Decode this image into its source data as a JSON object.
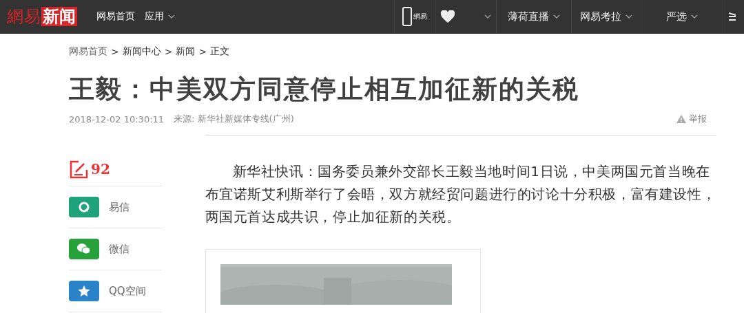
{
  "top_bar": {
    "logo": {
      "part_1": "網易",
      "part_2": "新闻"
    },
    "nav_links": [
      {
        "kind": "link",
        "label": "网易首页"
      },
      {
        "kind": "dropdown",
        "label": "应用"
      }
    ],
    "right_items": [
      {
        "kind": "phone",
        "label": "網易"
      },
      {
        "kind": "heart"
      },
      {
        "kind": "text",
        "label": "薄荷直播"
      },
      {
        "kind": "text",
        "label": "网易考拉"
      },
      {
        "kind": "text",
        "label": "严选"
      },
      {
        "kind": "cut"
      }
    ]
  },
  "breadcrumb": {
    "separator": ">",
    "items": [
      "网易首页",
      "新闻中心",
      "新闻",
      "正文"
    ]
  },
  "article": {
    "title": "王毅：中美双方同意停止相互加征新的关税",
    "time": "2018-12-02 10:30:11",
    "source": "来源: 新华社新媒体专线(广州)",
    "report": "举报",
    "paragraph": "新华社快讯：国务委员兼外交部长王毅当地时间1日说，中美两国元首当晚在布宜诺斯艾利斯举行了会晤，双方就经贸问题进行的讨论十分积极，富有建设性，两国元首达成共识，停止加征新的关税。"
  },
  "sidebar": {
    "comment_count": "92",
    "share": [
      {
        "kind": "yixin",
        "label": "易信",
        "color": "#1fa37a"
      },
      {
        "kind": "wechat",
        "label": "微信",
        "color": "#27a23a"
      },
      {
        "kind": "qzone",
        "label": "QQ空间",
        "color": "#2a83c9"
      }
    ]
  }
}
